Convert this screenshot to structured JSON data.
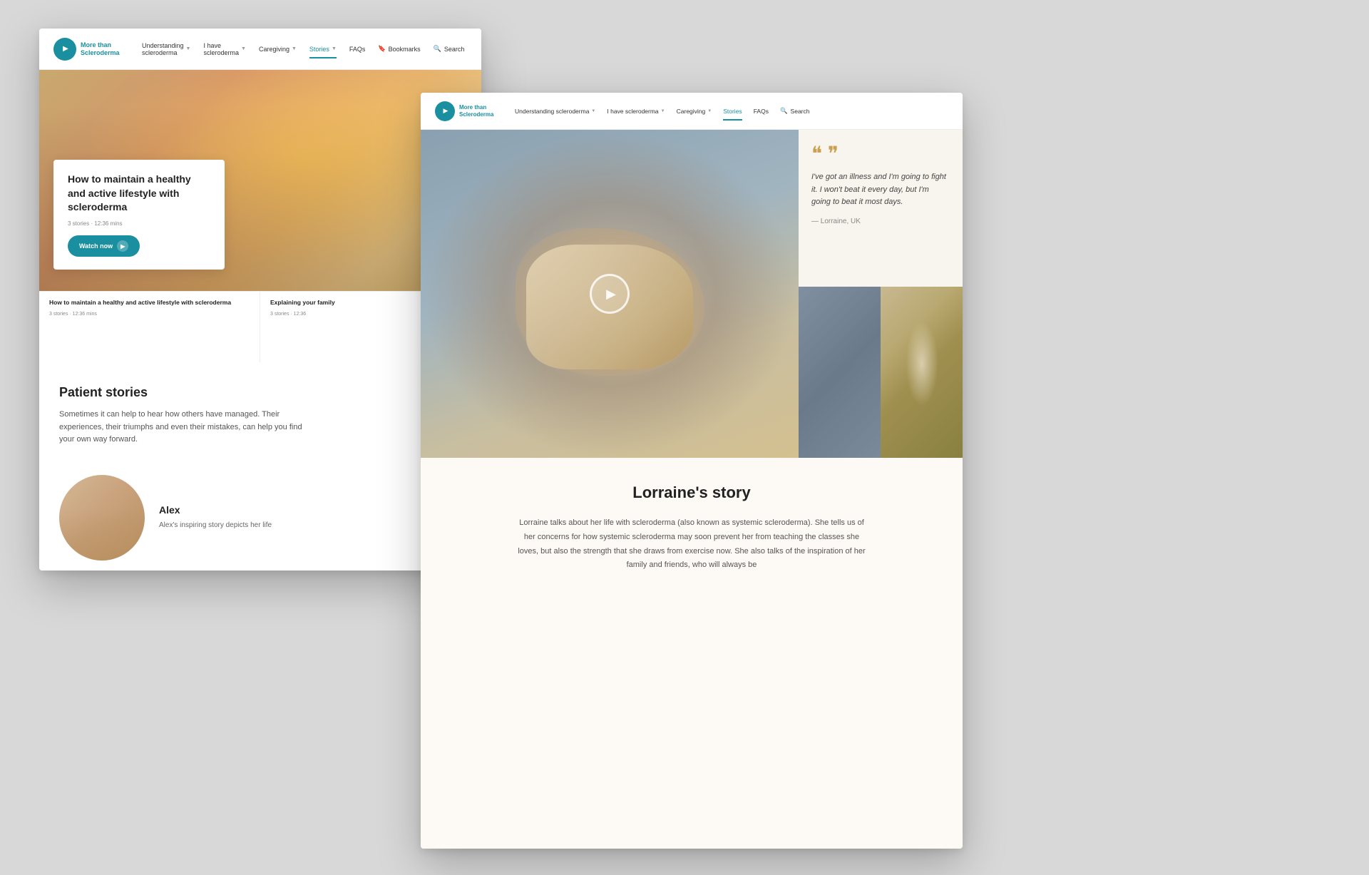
{
  "scene": {
    "background_color": "#d8d8d8"
  },
  "window_back": {
    "nav": {
      "logo_line1": "More than",
      "logo_line2": "Scleroderma",
      "logo_trademark": "™",
      "links": [
        {
          "label": "Understanding",
          "sublabel": "scleroderma",
          "has_dropdown": true,
          "active": false
        },
        {
          "label": "I have",
          "sublabel": "scleroderma",
          "has_dropdown": true,
          "active": false
        },
        {
          "label": "Caregiving",
          "has_dropdown": true,
          "active": false
        },
        {
          "label": "Stories",
          "has_dropdown": true,
          "active": true
        },
        {
          "label": "FAQs",
          "has_dropdown": false,
          "active": false
        },
        {
          "label": "Bookmarks",
          "has_dropdown": false,
          "active": false
        },
        {
          "label": "Search",
          "has_dropdown": false,
          "active": false
        }
      ]
    },
    "hero": {
      "card_title": "How to maintain a healthy and active lifestyle with scleroderma",
      "card_meta": "3 stories · 12:36 mins",
      "watch_button": "Watch now"
    },
    "carousel": [
      {
        "title": "How to maintain a healthy and active lifestyle with scleroderma",
        "meta": "3 stories · 12:36 mins"
      },
      {
        "title": "Explaining your family",
        "meta": "3 stories · 12:36"
      }
    ],
    "patient_stories": {
      "heading": "Patient stories",
      "body": "Sometimes it can help to hear how others have managed. Their experiences, their triumphs and even their mistakes, can help you find your own way forward."
    },
    "alex": {
      "name": "Alex",
      "description": "Alex's inspiring story depicts her life"
    }
  },
  "window_front": {
    "nav": {
      "logo_line1": "More than",
      "logo_line2": "Scleroderma",
      "links": [
        {
          "label": "Understanding scleroderma",
          "has_dropdown": true,
          "active": false
        },
        {
          "label": "I have scleroderma",
          "has_dropdown": true,
          "active": false
        },
        {
          "label": "Caregiving",
          "has_dropdown": true,
          "active": false
        },
        {
          "label": "Stories",
          "has_dropdown": false,
          "active": true
        },
        {
          "label": "FAQs",
          "has_dropdown": false,
          "active": false
        },
        {
          "label": "Search",
          "has_dropdown": false,
          "active": false
        }
      ]
    },
    "hero": {
      "play_label": "Play video"
    },
    "quote": {
      "quote_marks": "❝❞",
      "text": "I've got an illness and I'm going to fight it. I won't beat it every day, but I'm going to beat it most days.",
      "author": "— Lorraine, UK"
    },
    "story": {
      "title": "Lorraine's story",
      "body": "Lorraine talks about her life with scleroderma (also known as systemic scleroderma). She tells us of her concerns for how systemic scleroderma may soon prevent her from teaching the classes she loves, but also the strength that she draws from exercise now. She also talks of the inspiration of her family and friends, who will always be"
    }
  },
  "search_badge": {
    "label": "Search"
  }
}
